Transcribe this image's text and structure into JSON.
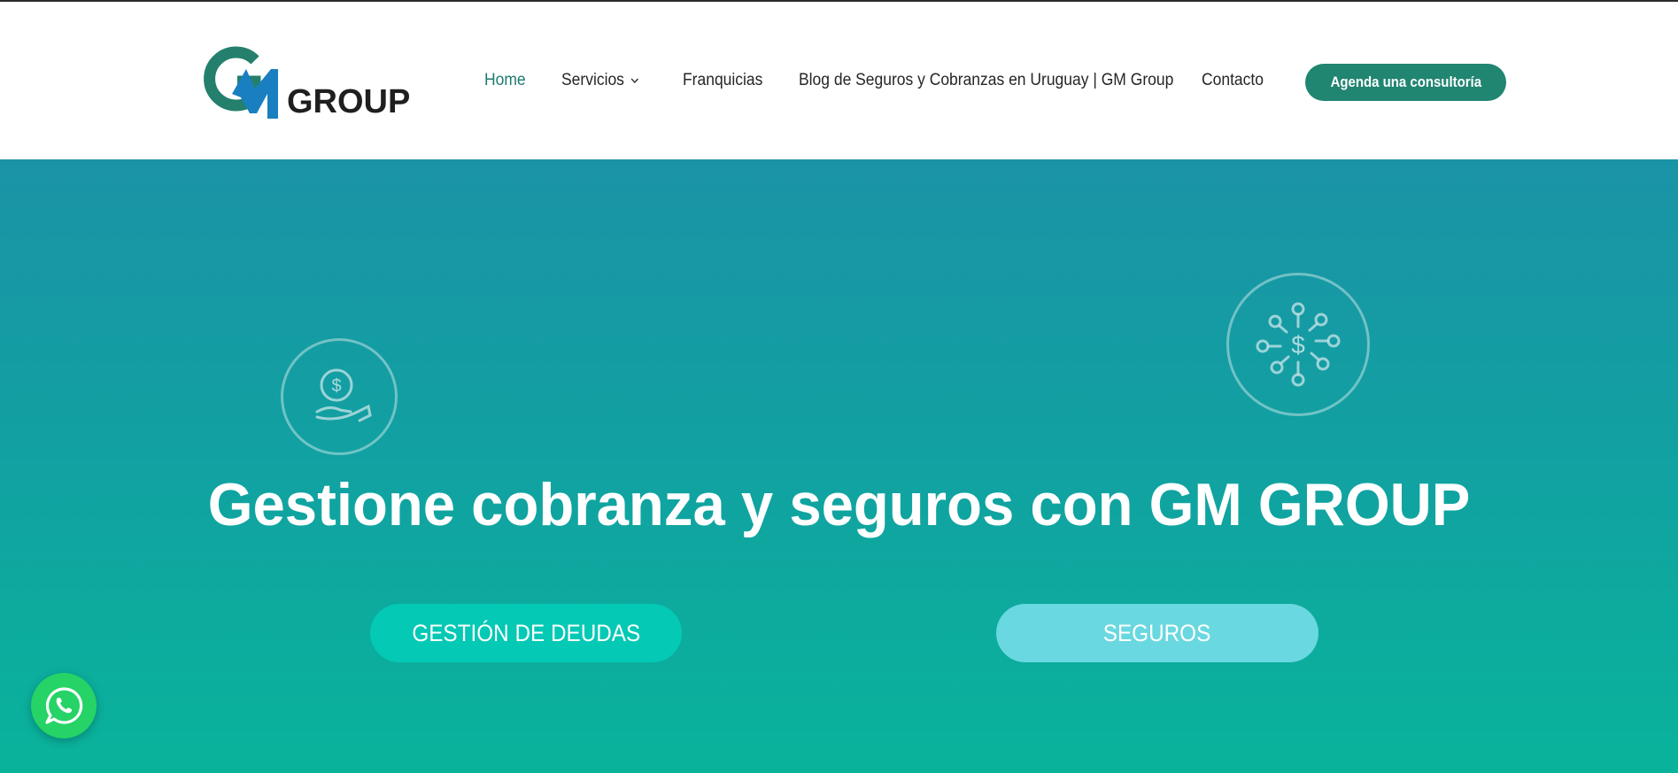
{
  "header": {
    "logo": {
      "text": "GROUP",
      "colors": {
        "g_green": "#24806d",
        "m_blue": "#1a7fc0"
      }
    },
    "nav": [
      {
        "label": "Home",
        "active": true
      },
      {
        "label": "Servicios",
        "has_dropdown": true
      },
      {
        "label": "Franquicias"
      },
      {
        "label": "Blog de Seguros y Cobranzas en Uruguay | GM Group"
      },
      {
        "label": "Contacto"
      }
    ],
    "cta_label": "Agenda una consultoría"
  },
  "hero": {
    "headline": "Gestione cobranza y seguros con GM GROUP",
    "buttons": {
      "deudas": "GESTIÓN DE DEUDAS",
      "seguros": "SEGUROS"
    },
    "icons": [
      "hand-coin-icon",
      "money-network-icon"
    ]
  },
  "floating": {
    "whatsapp_icon": "whatsapp-icon"
  },
  "colors": {
    "accent": "#208571",
    "hero_top": "#1a93a6",
    "hero_bottom": "#09b39b",
    "button_deudas": "#03c9b5",
    "button_seguros": "#69d8e0",
    "whatsapp": "#25d366"
  }
}
